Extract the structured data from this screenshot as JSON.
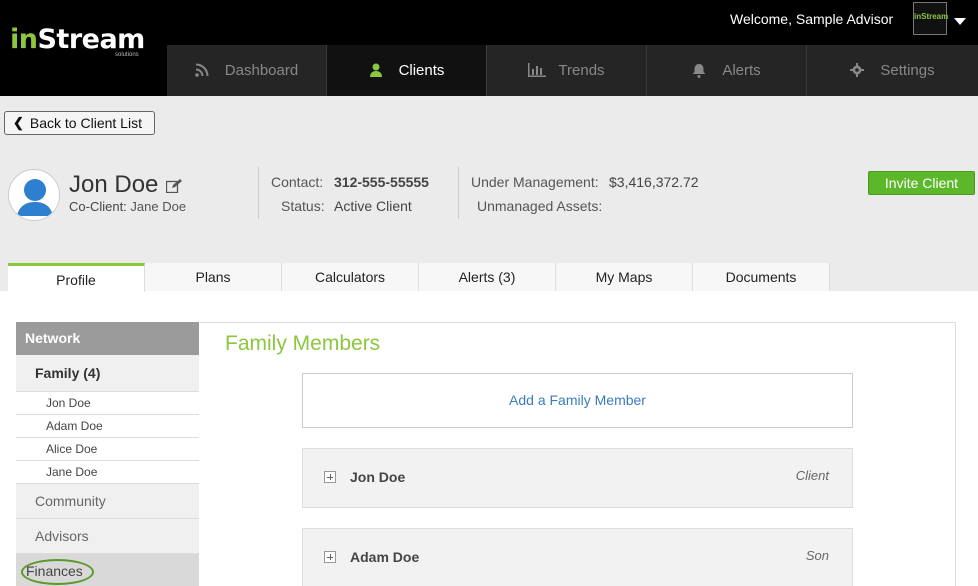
{
  "header": {
    "logo_in": "in",
    "logo_stream": "Stream",
    "logo_sub": "solutions",
    "welcome": "Welcome, Sample Advisor",
    "advisor_logo_text": "inStream"
  },
  "nav": {
    "items": [
      {
        "label": "Dashboard",
        "icon": "rss-icon"
      },
      {
        "label": "Clients",
        "icon": "user-icon"
      },
      {
        "label": "Trends",
        "icon": "bar-chart-icon"
      },
      {
        "label": "Alerts",
        "icon": "bell-icon"
      },
      {
        "label": "Settings",
        "icon": "gear-icon"
      }
    ],
    "active": "Clients"
  },
  "back_button": "Back to Client List",
  "client": {
    "name": "Jon Doe",
    "co_client_label": "Co-Client:",
    "co_client": "Jane Doe",
    "contact_label": "Contact:",
    "contact": "312-555-55555",
    "status_label": "Status:",
    "status": "Active Client",
    "under_mgmt_label": "Under Management:",
    "under_mgmt": "$3,416,372.72",
    "unmanaged_label": "Unmanaged Assets:",
    "unmanaged": ""
  },
  "invite_button": "Invite Client",
  "tabs": [
    {
      "label": "Profile"
    },
    {
      "label": "Plans"
    },
    {
      "label": "Calculators"
    },
    {
      "label": "Alerts (3)"
    },
    {
      "label": "My Maps"
    },
    {
      "label": "Documents"
    }
  ],
  "sidebar": {
    "heading": "Network",
    "family": "Family (4)",
    "family_members": [
      "Jon Doe",
      "Adam Doe",
      "Alice Doe",
      "Jane Doe"
    ],
    "community": "Community",
    "advisors": "Advisors",
    "finances": "Finances"
  },
  "main": {
    "title": "Family Members",
    "add_member": "Add a Family Member",
    "members": [
      {
        "name": "Jon Doe",
        "role": "Client"
      },
      {
        "name": "Adam Doe",
        "role": "Son"
      }
    ]
  },
  "colors": {
    "accent_green": "#8dc63f",
    "invite_green": "#5cb82a",
    "link_blue": "#3a7dbf"
  }
}
